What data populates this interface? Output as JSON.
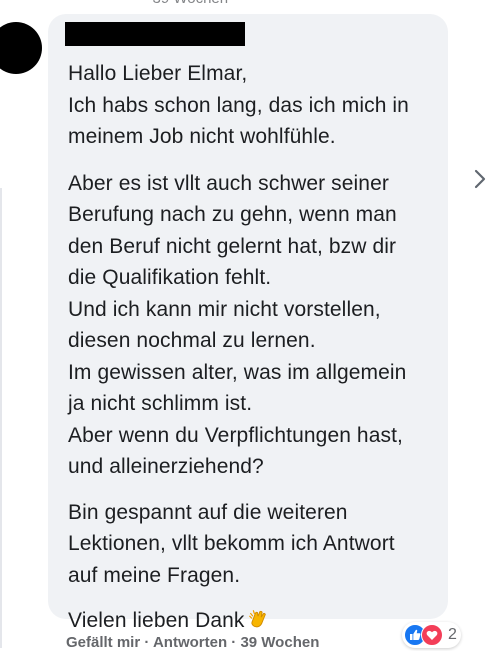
{
  "comment": {
    "paragraphs": [
      [
        "Hallo Lieber Elmar,",
        "Ich habs schon lang, das ich mich in",
        "meinem Job nicht wohlfühle."
      ],
      [
        "Aber es ist vllt auch schwer seiner",
        "Berufung nach zu gehn, wenn man",
        "den Beruf nicht gelernt hat, bzw dir",
        "die Qualifikation fehlt.",
        "Und ich kann mir nicht vorstellen,",
        "diesen nochmal zu lernen.",
        "Im gewissen alter, was im allgemein",
        "ja nicht schlimm ist.",
        "Aber wenn du Verpflichtungen hast,",
        "und alleinerziehend?"
      ],
      [
        "Bin gespannt auf die weiteren",
        "Lektionen, vllt bekomm ich Antwort",
        "auf meine Fragen."
      ],
      [
        "Vielen lieben Dank"
      ]
    ],
    "emoji": "clapping-hands"
  },
  "reactions": {
    "types": [
      "like",
      "love"
    ],
    "count": "2"
  },
  "colors": {
    "bubble": "#f0f2f5",
    "text": "#1c1e21",
    "secondary": "#65676b",
    "like": "#1877f2",
    "love": "#f33e58"
  }
}
